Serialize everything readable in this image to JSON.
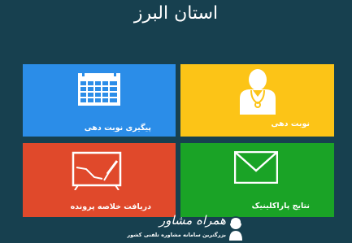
{
  "header": {
    "title": "استان البرز"
  },
  "tiles": {
    "tracking": {
      "label": "پیگیری نوبت دهی",
      "color": "#2b8de8",
      "icon": "calendar-icon"
    },
    "appointment": {
      "label": "نوبت دهی",
      "color": "#fcc417",
      "icon": "doctor-icon"
    },
    "summary": {
      "label": "دریافت خلاصه پرونده",
      "color": "#e0492b",
      "icon": "whiteboard-chart-icon"
    },
    "results": {
      "label": "نتایج پاراکلینیک",
      "color": "#1aa326",
      "icon": "envelope-icon"
    }
  },
  "footer": {
    "brand": "همراه مشاور",
    "tagline": "بزرگترین سامانه مشاوره تلفنی کشور",
    "icon": "headset-logo-icon"
  }
}
